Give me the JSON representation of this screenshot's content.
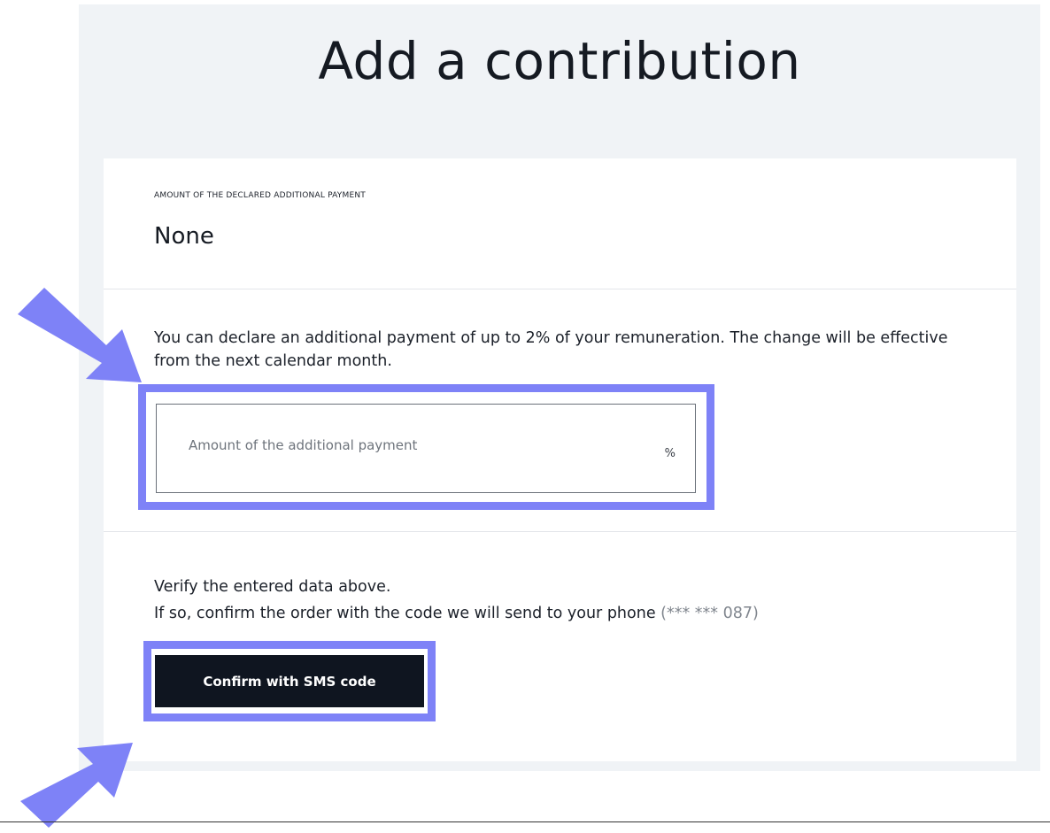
{
  "page": {
    "title": "Add a contribution"
  },
  "declared": {
    "caption": "AMOUNT OF THE DECLARED ADDITIONAL PAYMENT",
    "value": "None"
  },
  "info": {
    "text": "You can declare an additional payment of up to 2% of your remuneration. The change will be effective from the next calendar month."
  },
  "payment_input": {
    "placeholder": "Amount of the additional payment",
    "value": "",
    "suffix": "%"
  },
  "verify": {
    "line1": "Verify the entered data above.",
    "line2": "If so, confirm the order with the code we will send to your phone",
    "phone": "(*** *** 087)"
  },
  "actions": {
    "confirm_label": "Confirm with SMS code"
  },
  "colors": {
    "highlight": "#7e82f7",
    "panel_background": "#f0f3f6",
    "button_background": "#0f1520"
  },
  "annotations": {
    "arrows": [
      "arrow-icon",
      "arrow-icon"
    ]
  }
}
